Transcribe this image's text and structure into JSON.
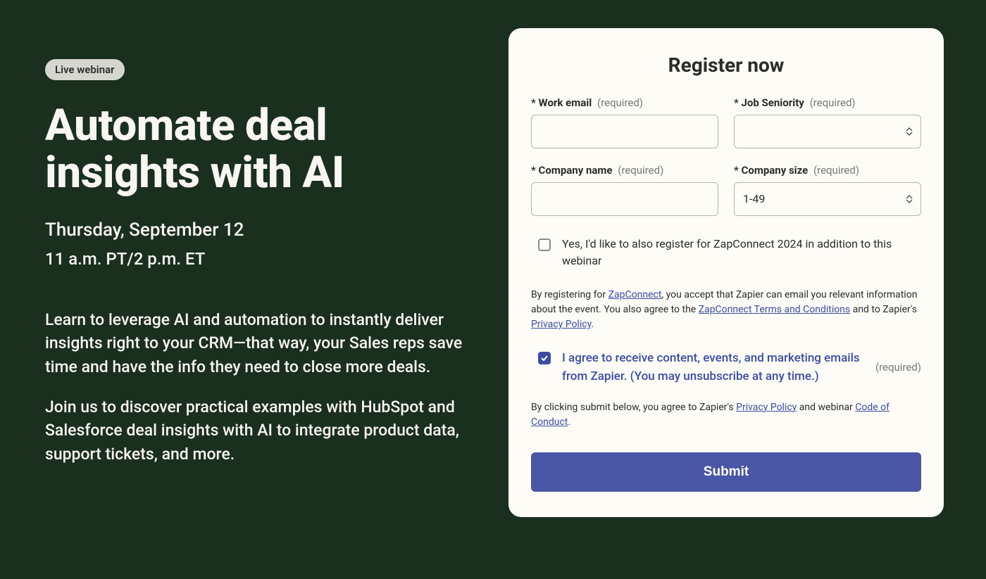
{
  "left": {
    "badge": "Live webinar",
    "title": "Automate deal insights with AI",
    "date": "Thursday, September 12",
    "time": "11 a.m. PT/2 p.m. ET",
    "para1": "Learn to leverage AI and automation to instantly deliver insights right to your CRM—that way, your Sales reps save time and have the info they need to close more deals.",
    "para2": "Join us to discover practical examples with HubSpot and Salesforce deal insights with AI to integrate product data, support tickets, and more."
  },
  "form": {
    "title": "Register now",
    "required_label": "(required)",
    "fields": {
      "email": {
        "label": "Work email",
        "value": ""
      },
      "seniority": {
        "label": "Job Seniority",
        "value": ""
      },
      "company": {
        "label": "Company name",
        "value": ""
      },
      "size": {
        "label": "Company size",
        "value": "1-49"
      }
    },
    "zapconnect_checkbox": {
      "checked": false,
      "label": "Yes, I'd like to also register for ZapConnect 2024 in addition to this webinar"
    },
    "legal1": {
      "t1": "By registering for ",
      "l1": "ZapConnect",
      "t2": ", you accept that Zapier can email you relevant information about the event. You also agree to the ",
      "l2": "ZapConnect Terms and Conditions",
      "t3": " and to Zapier's ",
      "l3": "Privacy Policy",
      "t4": "."
    },
    "agree": {
      "checked": true,
      "label": "I agree to receive content, events, and marketing emails from Zapier. (You may unsubscribe at any time.)"
    },
    "legal2": {
      "t1": "By clicking submit below, you agree to Zapier's ",
      "l1": "Privacy Policy",
      "t2": " and webinar ",
      "l2": "Code of Conduct",
      "t3": "."
    },
    "submit": "Submit"
  }
}
